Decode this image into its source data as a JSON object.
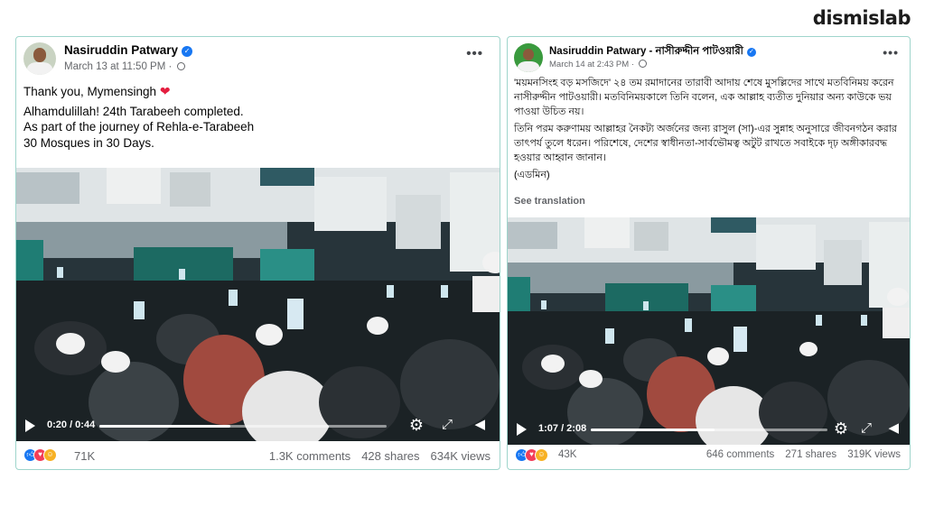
{
  "brand": {
    "logo_text": "dismislab"
  },
  "posts": [
    {
      "author": "Nasiruddin Patwary",
      "meta": "March 13 at 11:50 PM ·",
      "more": "•••",
      "paragraphs": [
        "Thank you, Mymensingh",
        "Alhamdulillah! 24th Tarabeeh completed.",
        "As part of the journey of Rehla-e-Tarabeeh",
        "30 Mosques in 30 Days."
      ],
      "heart": "❤",
      "video": {
        "time": "0:20 / 0:44",
        "progress": 0.455
      },
      "reactions_count": "71K",
      "comments": "1.3K comments",
      "shares": "428 shares",
      "views": "634K views"
    },
    {
      "author": "Nasiruddin Patwary - নাসীরুদ্দীন পাটওয়ারী",
      "meta": "March 14 at 2:43 PM ·",
      "more": "•••",
      "paragraphs": [
        "'ময়মনসিংহ বড় মসজিদে' ২৪ তম রমাদানের তারাবী আদায় শেষে মুসল্লিদের সাথে মতবিনিময় করেন নাসীরুদ্দীন পাটওয়ারী। মতবিনিময়কালে তিনি বলেন, এক আল্লাহ ব্যতীত দুনিয়ার অন্য কাউকে ভয় পাওয়া উচিত নয়।",
        "তিনি পরম করুণাময় আল্লাহর নৈকট্য অর্জনের জন্য রাসুল (সা)-এর সুন্নাহ অনুসারে জীবনগঠন করার তাৎপর্য তুলে ধরেন। পরিশেষে, দেশের স্বাধীনতা-সার্বভৌমত্ব অটুট রাখতে সবাইকে দৃঢ় অঙ্গীকারবদ্ধ হওয়ার আহ্বান জানান।",
        "(এডমিন)"
      ],
      "see_translation": "See translation",
      "video": {
        "time": "1:07 / 2:08",
        "progress": 0.523
      },
      "reactions_count": "43K",
      "comments": "646 comments",
      "shares": "271 shares",
      "views": "319K views"
    }
  ],
  "icons": {
    "verified": "verified-badge-icon",
    "globe": "globe-icon",
    "play": "play-icon",
    "settings": "gear-icon",
    "fullscreen": "expand-icon",
    "volume": "volume-icon",
    "reactions": [
      "like-icon",
      "love-icon",
      "care-icon"
    ]
  },
  "colors": {
    "accent": "#1877f2",
    "love": "#f33e58",
    "care": "#f7b125",
    "card_border": "#9fd5cc",
    "muted_text": "#65676b"
  }
}
